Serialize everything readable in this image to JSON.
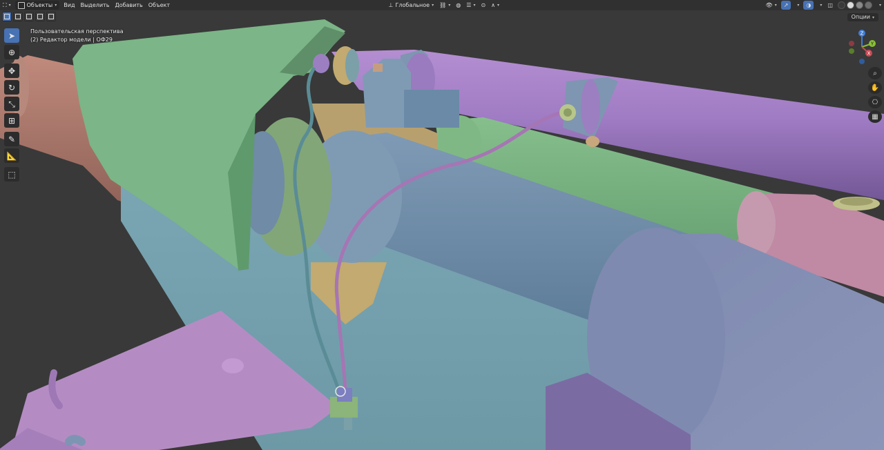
{
  "header": {
    "mode": "Объекты",
    "menus": [
      "Вид",
      "Выделить",
      "Добавить",
      "Объект"
    ],
    "transform_orientation": "Глобальное"
  },
  "options_label": "Опции",
  "viewport": {
    "perspective_label": "Пользовательская перспектива",
    "object_label": "(2) Редактор модели | ОФ29"
  },
  "gizmo": {
    "z": "Z",
    "y": "Y",
    "x": "X"
  },
  "colors": {
    "viewport_bg": "#393939",
    "header_bg": "#303030",
    "active_tool": "#4772b3",
    "axis_x": "#c74a54",
    "axis_y": "#8ac135",
    "axis_z": "#3f7dd6"
  }
}
